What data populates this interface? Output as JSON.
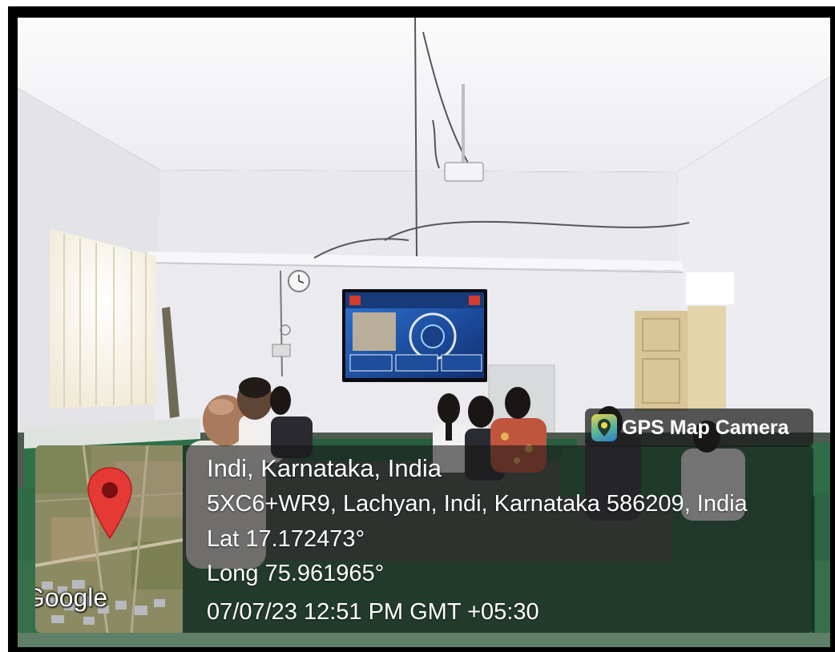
{
  "app_badge": {
    "label": "GPS Map Camera",
    "icon": "gps-map-camera-icon"
  },
  "location": {
    "title": "Indi, Karnataka, India",
    "address": "5XC6+WR9, Lachyan, Indi, Karnataka 586209, India",
    "latitude": "Lat 17.172473°",
    "longitude": "Long 75.961965°",
    "datetime": "07/07/23 12:51 PM GMT +05:30"
  },
  "map": {
    "provider_label": "Google",
    "marker_icon": "map-pin-icon"
  },
  "colors": {
    "overlay": "#1e1e1e",
    "marker": "#e53935",
    "text": "#ffffff"
  }
}
